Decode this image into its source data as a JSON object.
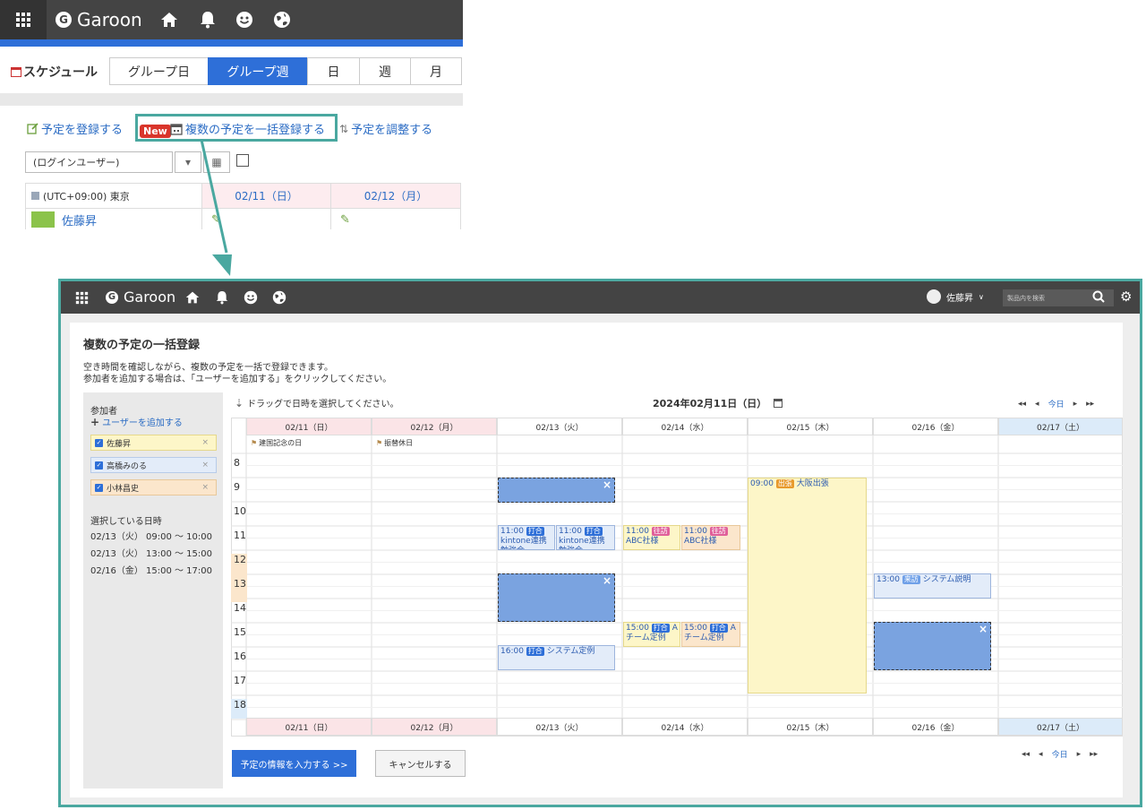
{
  "top": {
    "app_name": "Garoon",
    "logo_letter": "G",
    "icons": [
      "grid-icon",
      "home-icon",
      "bell-icon",
      "smile-icon",
      "globe-icon"
    ],
    "schedule_title": "スケジュール",
    "tabs": [
      {
        "label": "グループ日",
        "active": false
      },
      {
        "label": "グループ週",
        "active": true
      },
      {
        "label": "日",
        "active": false
      },
      {
        "label": "週",
        "active": false
      },
      {
        "label": "月",
        "active": false
      }
    ],
    "link_register": "予定を登録する",
    "new_badge": "New",
    "link_bulk": "複数の予定を一括登録する",
    "link_adjust": "予定を調整する",
    "user_select": "(ログインユーザー)",
    "timezone": "(UTC+09:00) 東京",
    "dates": [
      "02/11（日）",
      "02/12（月）"
    ],
    "user_name": "佐藤昇"
  },
  "win": {
    "app_name": "Garoon",
    "logo_letter": "G",
    "user_name": "佐藤昇",
    "search_placeholder": "製品内を検索",
    "title": "複数の予定の一括登録",
    "desc1": "空き時間を確認しながら、複数の予定を一括で登録できます。",
    "desc2": "参加者を追加する場合は、「ユーザーを追加する」をクリックしてください。",
    "side": {
      "participants_label": "参加者",
      "add_user": "ユーザーを追加する",
      "participants": [
        {
          "name": "佐藤昇",
          "bg": "#fdf6c8",
          "border": "#e5d88a"
        },
        {
          "name": "高橋みのる",
          "bg": "#e3ecf9",
          "border": "#b7cbe9"
        },
        {
          "name": "小林昌史",
          "bg": "#fbe6cc",
          "border": "#e8c89a"
        }
      ],
      "selected_label": "選択している日時",
      "selected": [
        "02/13（火） 09:00 ～ 10:00",
        "02/13（火） 13:00 ～ 15:00",
        "02/16（金） 15:00 ～ 17:00"
      ]
    },
    "drag_hint": "ドラッグで日時を選択してください。",
    "current_date": "2024年02月11日（日）",
    "today": "今日",
    "days": [
      {
        "label": "02/11（日）",
        "type": "sun"
      },
      {
        "label": "02/12（月）",
        "type": "sun"
      },
      {
        "label": "02/13（火）",
        "type": "wk"
      },
      {
        "label": "02/14（水）",
        "type": "wk"
      },
      {
        "label": "02/15（木）",
        "type": "wk"
      },
      {
        "label": "02/16（金）",
        "type": "wk"
      },
      {
        "label": "02/17（土）",
        "type": "sat"
      }
    ],
    "holidays": [
      "建国記念の日",
      "振替休日"
    ],
    "hours": [
      "8",
      "9",
      "10",
      "11",
      "12",
      "13",
      "14",
      "15",
      "16",
      "17",
      "18"
    ],
    "events": {
      "e1_time": "11:00",
      "e1_tag": "打合",
      "e1_text": "kintone連携勉強会",
      "e2_time": "11:00",
      "e2_tag": "打合",
      "e2_text": "kintone連携勉強会",
      "e3_time": "11:00",
      "e3_tag": "往訪",
      "e3_text": "ABC社様",
      "e4_time": "11:00",
      "e4_tag": "往訪",
      "e4_text": "ABC社様",
      "e5_time": "15:00",
      "e5_tag": "打合",
      "e5_text": "Aチーム定例",
      "e6_time": "15:00",
      "e6_tag": "打合",
      "e6_text": "Aチーム定例",
      "e7_time": "16:00",
      "e7_tag": "打合",
      "e7_text": "システム定例",
      "e8_time": "09:00",
      "e8_tag": "出張",
      "e8_text": "大阪出張",
      "e9_time": "13:00",
      "e9_tag": "来訪",
      "e9_text": "システム説明"
    },
    "btn_primary": "予定の情報を入力する >>",
    "btn_cancel": "キャンセルする"
  }
}
